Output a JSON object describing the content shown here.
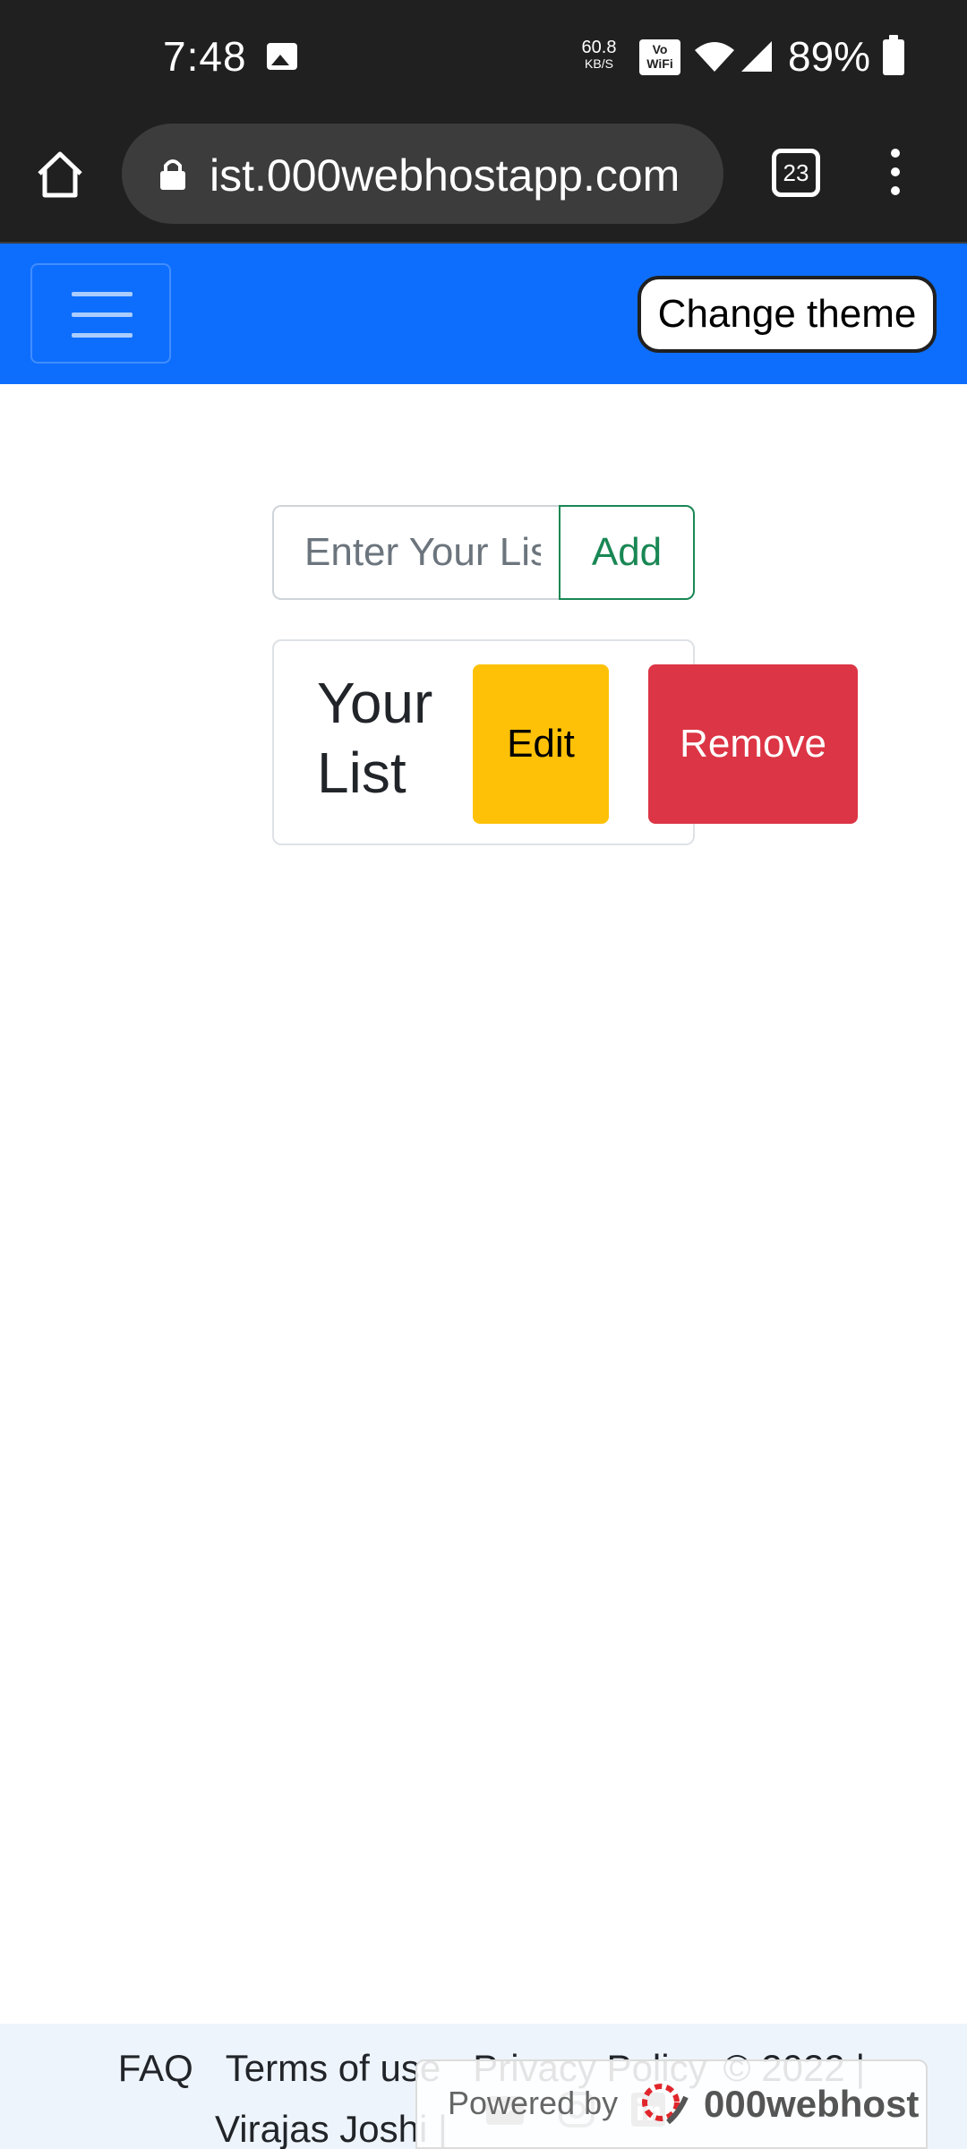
{
  "status_bar": {
    "time": "7:48",
    "speed_value": "60.8",
    "speed_unit": "KB/S",
    "vowifi": "Vo WiFi",
    "battery": "89%"
  },
  "browser": {
    "url": "ist.000webhostapp.com",
    "tab_count": "23"
  },
  "navbar": {
    "theme_button_label": "Change theme"
  },
  "form": {
    "input_placeholder": "Enter Your List",
    "add_label": "Add"
  },
  "list": {
    "items": [
      {
        "text": "Your List",
        "edit_label": "Edit",
        "remove_label": "Remove"
      }
    ]
  },
  "footer": {
    "links": [
      "FAQ",
      "Terms of use",
      "Privacy Policy"
    ],
    "copyright": "© 2022 |",
    "author": "Virajas Joshi |"
  },
  "hosting_badge": {
    "powered_by": "Powered by",
    "host_name": "000webhost"
  },
  "colors": {
    "navbar": "#0d6efd",
    "add_outline": "#198754",
    "edit": "#ffc107",
    "remove": "#dc3545"
  }
}
